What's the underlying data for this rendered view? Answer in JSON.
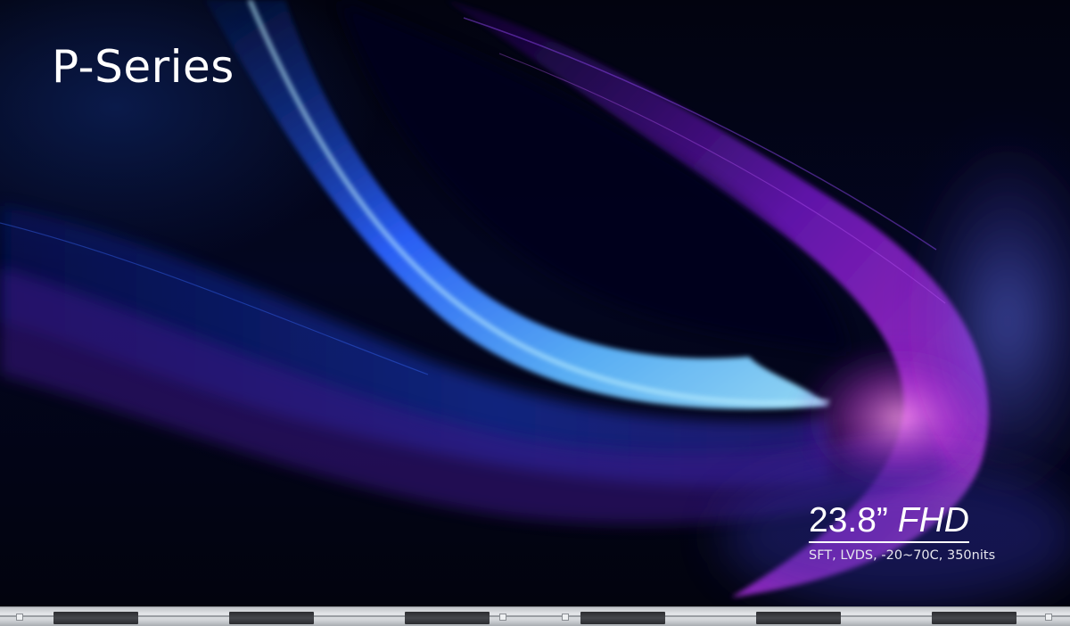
{
  "product": {
    "series_title": "P-Series",
    "headline_size": "23.8”",
    "headline_resolution": "FHD",
    "spec_line": "SFT, LVDS, -20~70C, 350nits"
  },
  "colors": {
    "title_text": "#ffffff",
    "background_dark": "#02030f",
    "wave_blue": "#3a7bff",
    "wave_cyan": "#7fd4ff",
    "wave_purple": "#7a1fc4",
    "wave_magenta": "#e14bd8",
    "bezel_silver": "#d7dadd",
    "connector_dark": "#35363b"
  }
}
